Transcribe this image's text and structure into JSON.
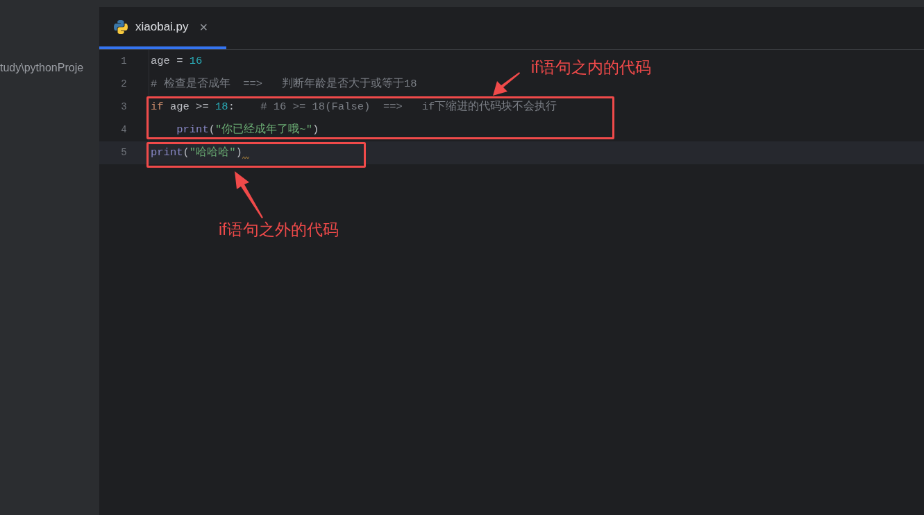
{
  "sidebar": {
    "path_text": "tudy\\pythonProje"
  },
  "tabs": [
    {
      "label": "xiaobai.py",
      "selected": true,
      "close": "×"
    }
  ],
  "code_lines": [
    {
      "number": "1",
      "current": false,
      "warning": false,
      "tokens": [
        {
          "text": "age = ",
          "kind": "plain"
        },
        {
          "text": "16",
          "kind": "number"
        }
      ]
    },
    {
      "number": "2",
      "current": false,
      "warning": false,
      "tokens": [
        {
          "text": "# 检查是否成年  ==>   判断年龄是否大于或等于18",
          "kind": "comment"
        }
      ]
    },
    {
      "number": "3",
      "current": false,
      "warning": false,
      "tokens": [
        {
          "text": "if",
          "kind": "keyword"
        },
        {
          "text": " age >= ",
          "kind": "plain"
        },
        {
          "text": "18",
          "kind": "number"
        },
        {
          "text": ":    ",
          "kind": "plain"
        },
        {
          "text": "# 16 >= 18(False)  ==>   if下缩进的代码块不会执行",
          "kind": "comment"
        }
      ]
    },
    {
      "number": "4",
      "current": false,
      "warning": false,
      "tokens": [
        {
          "text": "    print",
          "kind": "builtin"
        },
        {
          "text": "(",
          "kind": "plain"
        },
        {
          "text": "\"你已经成年了哦~\"",
          "kind": "string"
        },
        {
          "text": ")",
          "kind": "plain"
        }
      ]
    },
    {
      "number": "5",
      "current": true,
      "warning": true,
      "tokens": [
        {
          "text": "print",
          "kind": "builtin"
        },
        {
          "text": "(",
          "kind": "plain"
        },
        {
          "text": "\"哈哈哈\"",
          "kind": "string"
        },
        {
          "text": ")",
          "kind": "plain"
        }
      ]
    }
  ],
  "annotations": [
    {
      "label": "if语句之内的代码"
    },
    {
      "label": "if语句之外的代码"
    }
  ]
}
